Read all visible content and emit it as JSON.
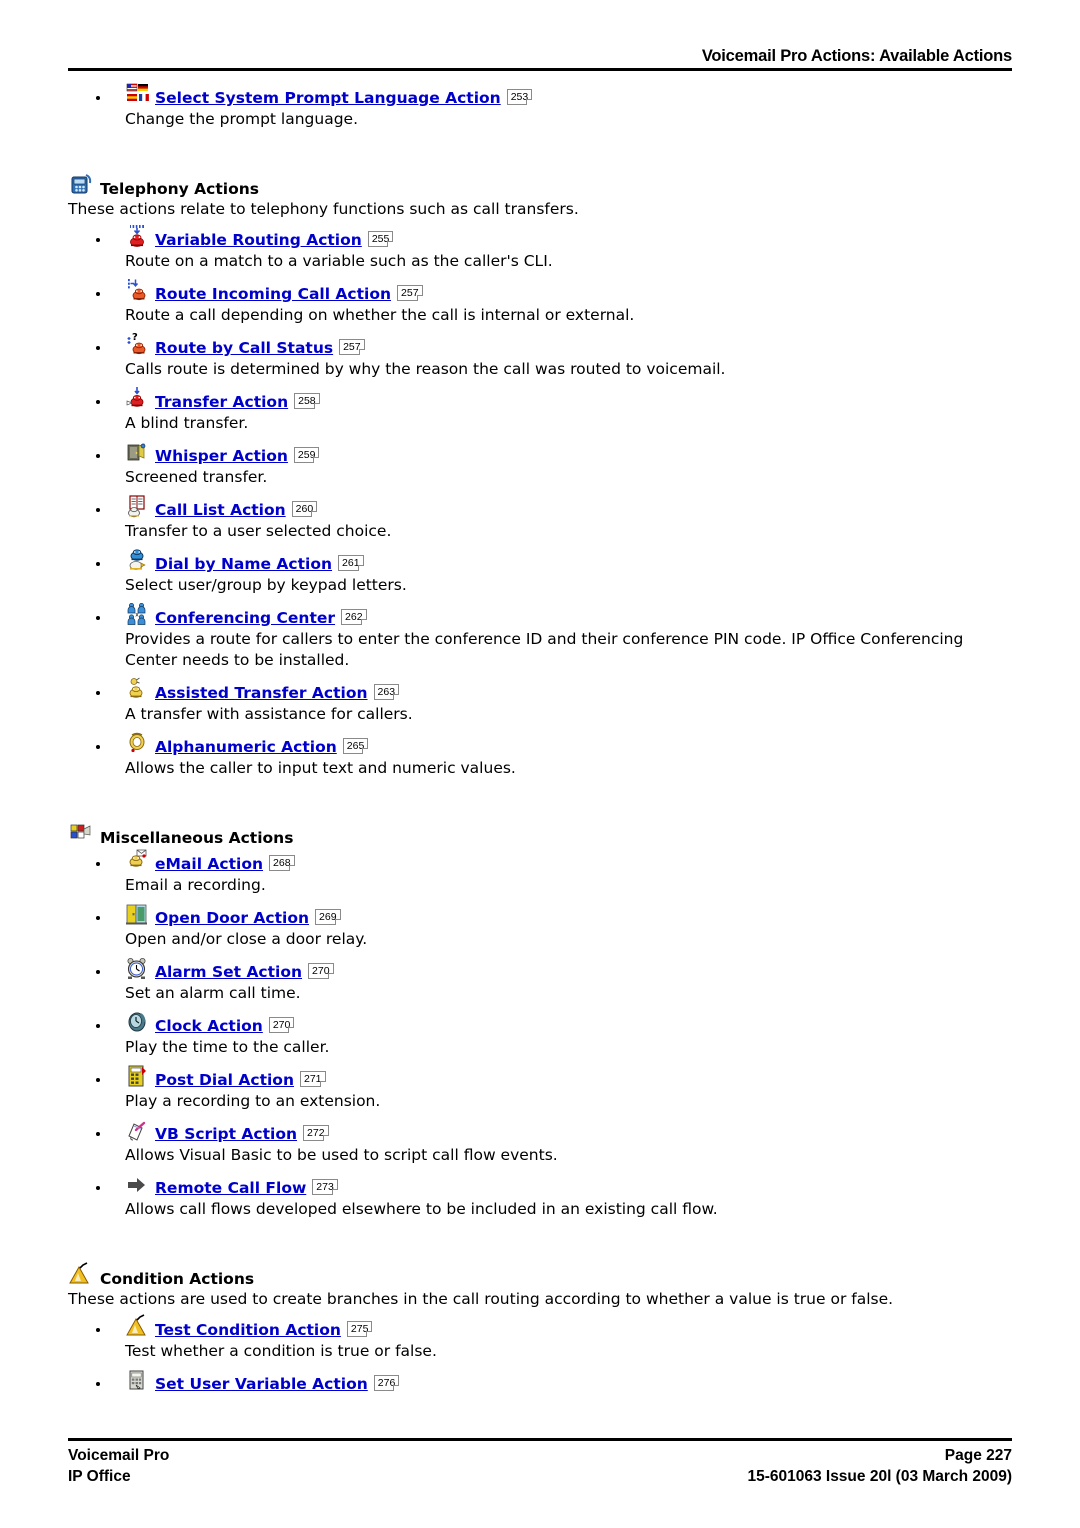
{
  "header": {
    "title": "Voicemail Pro Actions: Available Actions"
  },
  "intro_item": {
    "icon": "flags-icon",
    "label": "Select System Prompt Language Action",
    "page": "253",
    "desc": "Change the prompt language."
  },
  "groups": [
    {
      "icon": "telephone-icon",
      "title": "Telephony Actions",
      "desc": "These actions relate to telephony functions such as call transfers.",
      "items": [
        {
          "icon": "variable-routing-icon",
          "label": "Variable Routing Action",
          "page": "255",
          "desc": "Route on a match to a variable such as the caller's CLI."
        },
        {
          "icon": "route-incoming-call-icon",
          "label": "Route Incoming Call Action",
          "page": "257",
          "desc": "Route a call depending on whether the call is internal or external."
        },
        {
          "icon": "route-by-call-status-icon",
          "label": "Route by Call Status",
          "page": "257",
          "desc": "Calls route is determined by why the reason the call was routed to voicemail."
        },
        {
          "icon": "transfer-icon",
          "label": "Transfer Action",
          "page": "258",
          "desc": "A blind transfer."
        },
        {
          "icon": "whisper-icon",
          "label": "Whisper Action",
          "page": "259",
          "desc": "Screened transfer."
        },
        {
          "icon": "call-list-icon",
          "label": "Call List Action",
          "page": "260",
          "desc": "Transfer to a user selected choice."
        },
        {
          "icon": "dial-by-name-icon",
          "label": "Dial by Name Action",
          "page": "261",
          "desc": "Select user/group by keypad letters."
        },
        {
          "icon": "conferencing-center-icon",
          "label": "Conferencing Center",
          "page": "262",
          "desc": "Provides a route for callers to enter the conference ID and their conference PIN code. IP Office Conferencing Center needs to be installed."
        },
        {
          "icon": "assisted-transfer-icon",
          "label": "Assisted Transfer Action",
          "page": "263",
          "desc": "A transfer with assistance for callers."
        },
        {
          "icon": "alphanumeric-icon",
          "label": "Alphanumeric Action",
          "page": "265",
          "desc": "Allows the caller to input text and numeric values."
        }
      ]
    },
    {
      "icon": "miscellaneous-icon",
      "title": "Miscellaneous Actions",
      "desc": "",
      "items": [
        {
          "icon": "email-icon",
          "label": "eMail Action",
          "page": "268",
          "desc": "Email a recording."
        },
        {
          "icon": "open-door-icon",
          "label": "Open Door Action",
          "page": "269",
          "desc": "Open and/or close a door relay."
        },
        {
          "icon": "alarm-set-icon",
          "label": "Alarm Set Action",
          "page": "270",
          "desc": "Set an alarm call time."
        },
        {
          "icon": "clock-icon",
          "label": "Clock Action",
          "page": "270",
          "desc": "Play the time to the caller."
        },
        {
          "icon": "post-dial-icon",
          "label": "Post Dial Action",
          "page": "271",
          "desc": "Play a recording to an extension."
        },
        {
          "icon": "vb-script-icon",
          "label": "VB Script Action",
          "page": "272",
          "desc": "Allows Visual Basic to be used to script call flow events."
        },
        {
          "icon": "remote-call-flow-icon",
          "label": "Remote Call Flow",
          "page": "273",
          "desc": "Allows call flows developed elsewhere to be included in an existing call flow."
        }
      ]
    },
    {
      "icon": "condition-icon",
      "title": "Condition Actions",
      "desc": "These actions are used to create branches in the call routing according to whether a value is true or false.",
      "items": [
        {
          "icon": "test-condition-icon",
          "label": "Test Condition Action",
          "page": "275",
          "desc": "Test whether a condition is true or false."
        },
        {
          "icon": "set-user-variable-icon",
          "label": "Set User Variable Action",
          "page": "276",
          "desc": ""
        }
      ]
    }
  ],
  "footer": {
    "left_line1": "Voicemail Pro",
    "left_line2": "IP Office",
    "right_line1": "Page 227",
    "right_line2": "15-601063 Issue 20l (03 March 2009)"
  },
  "colors": {
    "link": "#0000CC",
    "text": "#000000",
    "rule": "#000000"
  }
}
